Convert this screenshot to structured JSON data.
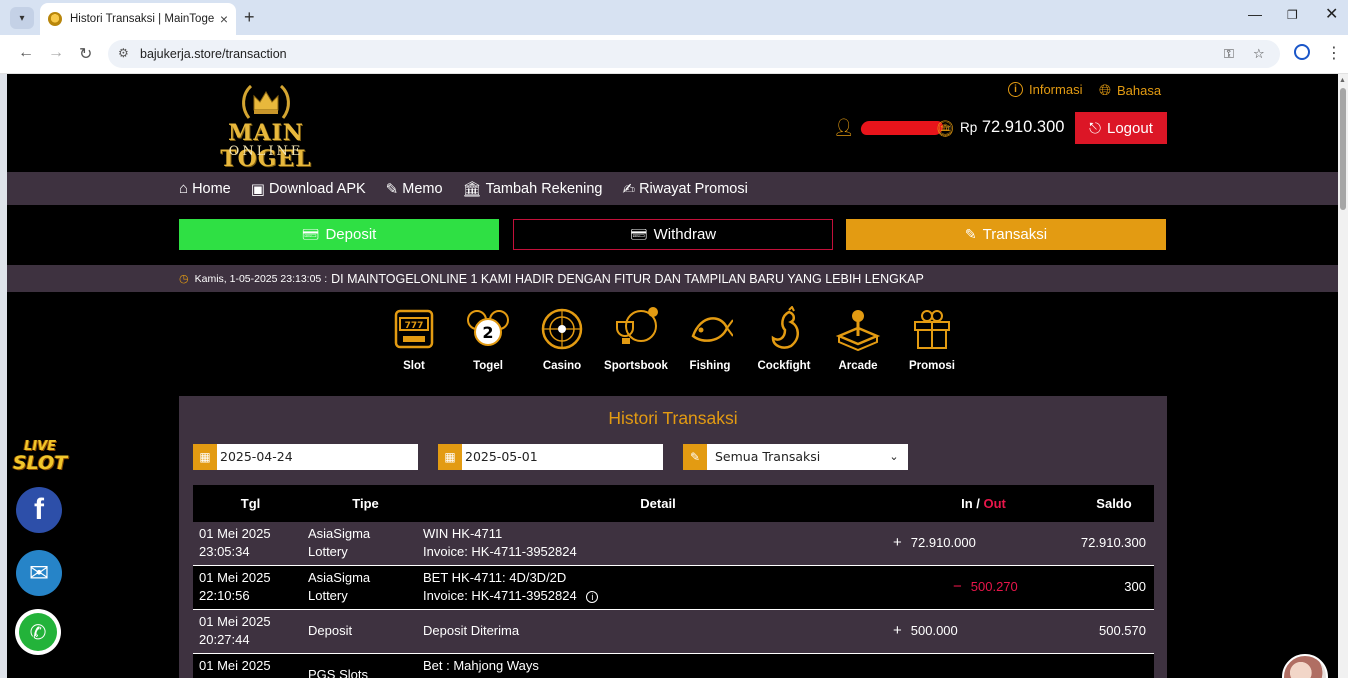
{
  "browser": {
    "tab_title": "Histori Transaksi | MainTogelOn",
    "url": "bajukerja.store/transaction"
  },
  "header": {
    "logo_main": "MAIN TOGEL",
    "logo_sub": "ONLINE",
    "info_label": "Informasi",
    "language_label": "Bahasa",
    "currency": "Rp",
    "balance": "72.910.300",
    "logout_label": "Logout"
  },
  "menu": [
    {
      "label": "Home",
      "icon": "home-icon"
    },
    {
      "label": "Download APK",
      "icon": "android-icon"
    },
    {
      "label": "Memo",
      "icon": "memo-icon"
    },
    {
      "label": "Tambah Rekening",
      "icon": "bank-icon"
    },
    {
      "label": "Riwayat Promosi",
      "icon": "history-icon"
    }
  ],
  "actions": {
    "deposit": "Deposit",
    "withdraw": "Withdraw",
    "transaksi": "Transaksi"
  },
  "marquee": {
    "time": "Kamis, 1-05-2025 23:13:05 :",
    "text": "DI MAINTOGELONLINE 1 KAMI HADIR DENGAN FITUR DAN TAMPILAN BARU YANG LEBIH LENGKAP"
  },
  "games": [
    "Slot",
    "Togel",
    "Casino",
    "Sportsbook",
    "Fishing",
    "Cockfight",
    "Arcade",
    "Promosi"
  ],
  "side": {
    "live_slot_1": "LIVE",
    "live_slot_2": "SLOT"
  },
  "history": {
    "title": "Histori Transaksi",
    "date_from": "2025-04-24",
    "date_to": "2025-05-01",
    "type_filter": "Semua Transaksi",
    "columns": {
      "tgl": "Tgl",
      "tipe": "Tipe",
      "detail": "Detail",
      "in": "In /",
      "out": "Out",
      "saldo": "Saldo"
    },
    "rows": [
      {
        "date": "01 Mei 2025",
        "time": "23:05:34",
        "type1": "AsiaSigma",
        "type2": "Lottery",
        "detail1": "WIN HK-4711",
        "detail2": "Invoice: HK-4711-3952824",
        "amount": "72.910.000",
        "direction": "in",
        "sign": "+",
        "saldo": "72.910.300"
      },
      {
        "date": "01 Mei 2025",
        "time": "22:10:56",
        "type1": "AsiaSigma",
        "type2": "Lottery",
        "detail1": "BET HK-4711: 4D/3D/2D",
        "detail2": "Invoice: HK-4711-3952824",
        "amount": "500.270",
        "direction": "out",
        "sign": "−",
        "saldo": "300"
      },
      {
        "date": "01 Mei 2025",
        "time": "20:27:44",
        "type1": "Deposit",
        "type2": "",
        "detail1": "Deposit Diterima",
        "detail2": "",
        "amount": "500.000",
        "direction": "in",
        "sign": "+",
        "saldo": "500.570"
      },
      {
        "date": "01 Mei 2025",
        "time": "",
        "type1": "PGS Slots",
        "type2": "",
        "detail1": "Bet : Mahjong Ways",
        "detail2": "",
        "amount": "",
        "direction": "out",
        "sign": "−",
        "saldo": ""
      }
    ]
  },
  "colors": {
    "accent_orange": "#e39b12",
    "deposit_green": "#2fe044",
    "logout_red": "#dc1626",
    "panel_purple": "#3e3240",
    "out_red": "#e8164a"
  }
}
